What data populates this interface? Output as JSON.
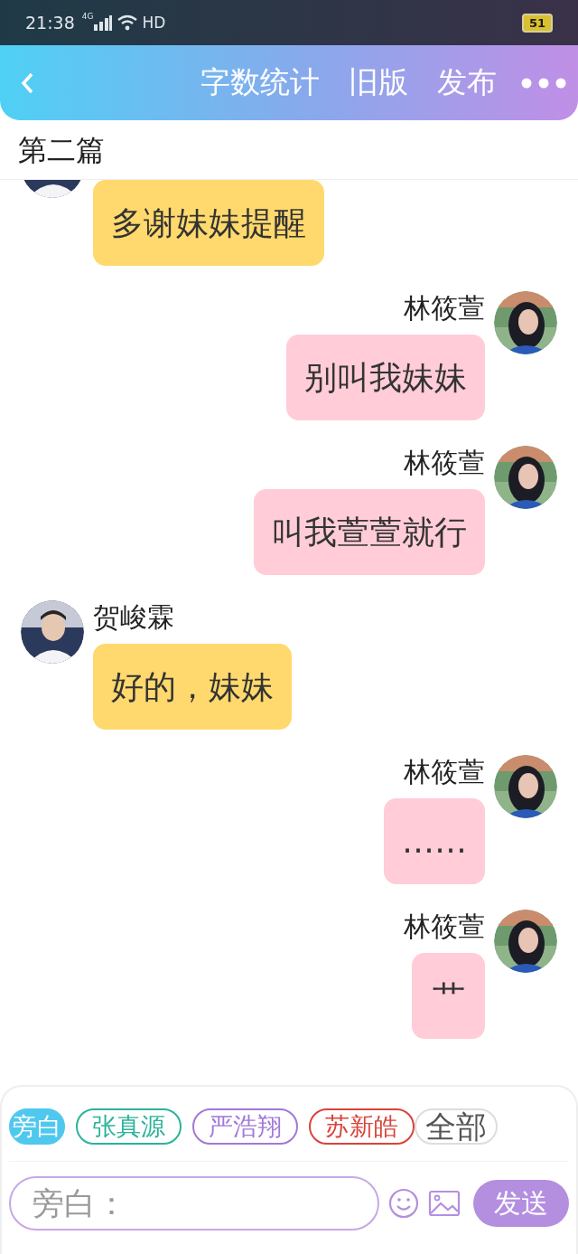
{
  "status_bar": {
    "time": "21:38",
    "network": "4G",
    "hd": "HD",
    "battery": "51"
  },
  "header": {
    "actions": [
      "字数统计",
      "旧版",
      "发布"
    ]
  },
  "chapter_title": "第二篇",
  "messages": [
    {
      "kind": "left",
      "text": "多谢妹妹提醒"
    },
    {
      "kind": "right",
      "sender": "林筱萱",
      "text": "别叫我妹妹"
    },
    {
      "kind": "right",
      "sender": "林筱萱",
      "text": "叫我萱萱就行"
    },
    {
      "kind": "left",
      "sender": "贺峻霖",
      "text": "好的，妹妹"
    },
    {
      "kind": "right",
      "sender": "林筱萱",
      "text": "……"
    },
    {
      "kind": "right",
      "sender": "林筱萱",
      "text": "艹"
    }
  ],
  "characters": [
    {
      "label": "旁白",
      "color": "#4fc8ee",
      "selected": true
    },
    {
      "label": "张真源",
      "color": "#2bb39a",
      "selected": false
    },
    {
      "label": "严浩翔",
      "color": "#a178d8",
      "selected": false
    },
    {
      "label": "苏新皓",
      "color": "#d9443a",
      "selected": false
    }
  ],
  "all_button": "全部",
  "input": {
    "placeholder": "旁白："
  },
  "send_button": "发送"
}
